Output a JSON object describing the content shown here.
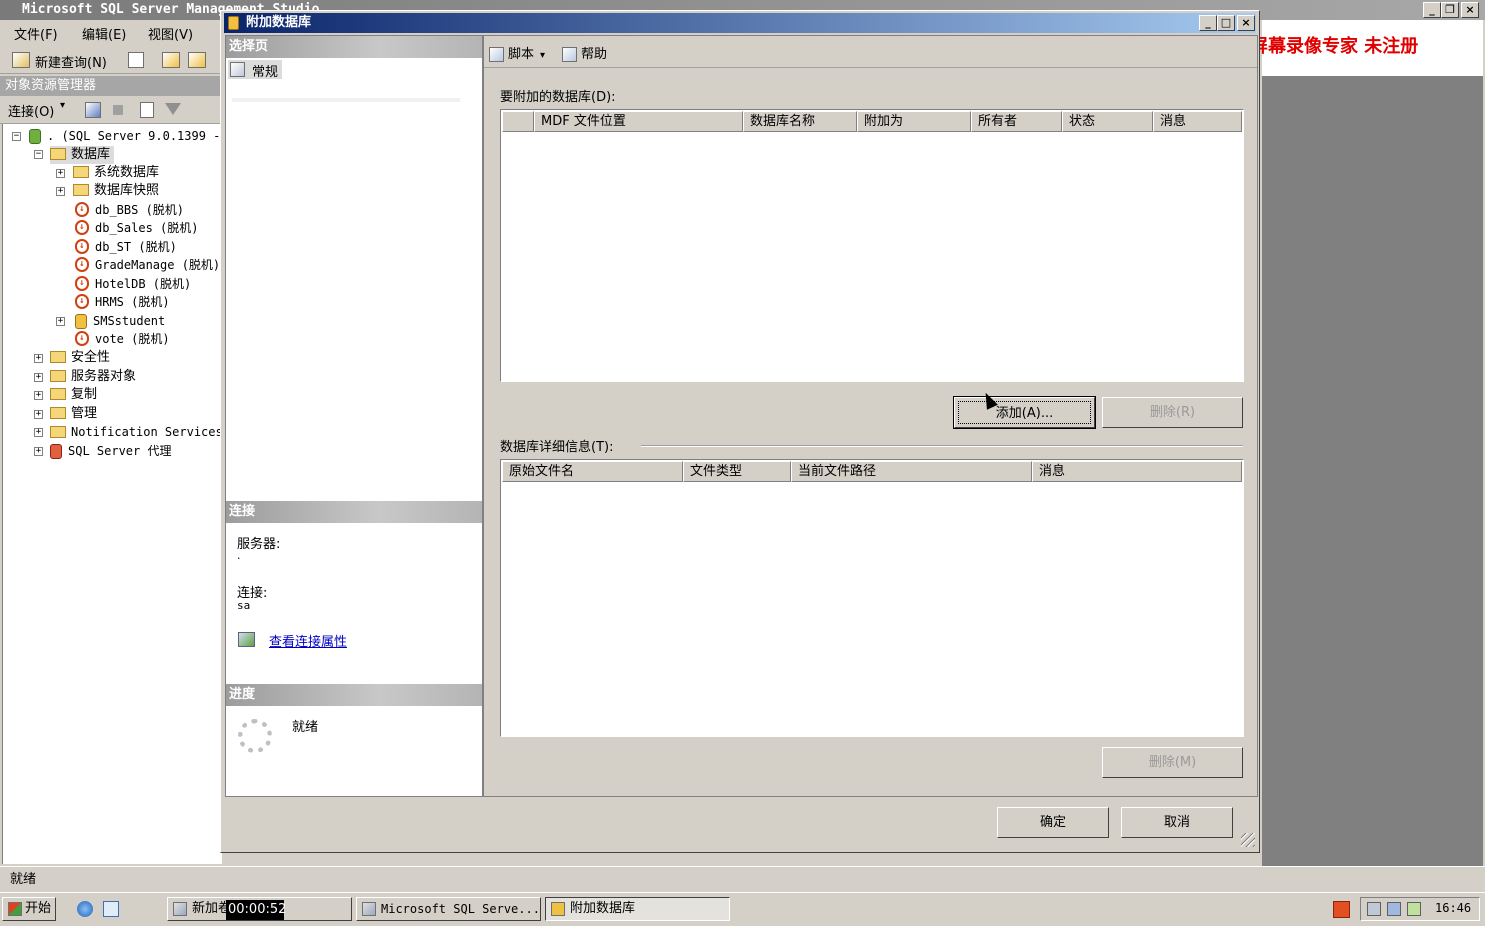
{
  "app": {
    "title": "Microsoft SQL Server Management Studio",
    "menu": [
      "文件(F)",
      "编辑(E)",
      "视图(V)"
    ],
    "toolbar": {
      "new_query": "新建查询(N)"
    },
    "object_explorer": {
      "header": "对象资源管理器",
      "connect_label": "连接(O)",
      "tree": {
        "server": ". (SQL Server 9.0.1399 -",
        "databases": "数据库",
        "system_databases": "系统数据库",
        "snapshots": "数据库快照",
        "db_items": [
          "db_BBS (脱机)",
          "db_Sales (脱机)",
          "db_ST (脱机)",
          "GradeManage (脱机)",
          "HotelDB (脱机)",
          "HRMS (脱机)"
        ],
        "smsstudent": "SMSstudent",
        "vote": "vote (脱机)",
        "security": "安全性",
        "server_objects": "服务器对象",
        "replication": "复制",
        "management": "管理",
        "notification": "Notification Services",
        "agent": "SQL Server 代理"
      }
    },
    "status": "就绪"
  },
  "watermark": "屏幕录像专家  未注册",
  "dialog": {
    "title": "附加数据库",
    "left": {
      "select_page_header": "选择页",
      "page_general": "常规",
      "connection_header": "连接",
      "server_label": "服务器:",
      "server_value": ".",
      "connection_label": "连接:",
      "connection_value": "sa",
      "view_props_link": "查看连接属性",
      "progress_header": "进度",
      "progress_status": "就绪"
    },
    "toolbar": {
      "script": "脚本",
      "help": "帮助"
    },
    "attach_label": "要附加的数据库(D):",
    "attach_columns": [
      "",
      "MDF 文件位置",
      "数据库名称",
      "附加为",
      "所有者",
      "状态",
      "消息"
    ],
    "add_button": "添加(A)...",
    "remove_button": "删除(R)",
    "details_label": "数据库详细信息(T):",
    "details_columns": [
      "原始文件名",
      "文件类型",
      "当前文件路径",
      "消息"
    ],
    "remove_details_button": "删除(M)",
    "ok_button": "确定",
    "cancel_button": "取消"
  },
  "taskbar": {
    "start": "开始",
    "tasks": [
      "新加卷",
      "Microsoft SQL Serve...",
      "附加数据库"
    ],
    "timer": "00:00:52",
    "clock": "16:46"
  }
}
